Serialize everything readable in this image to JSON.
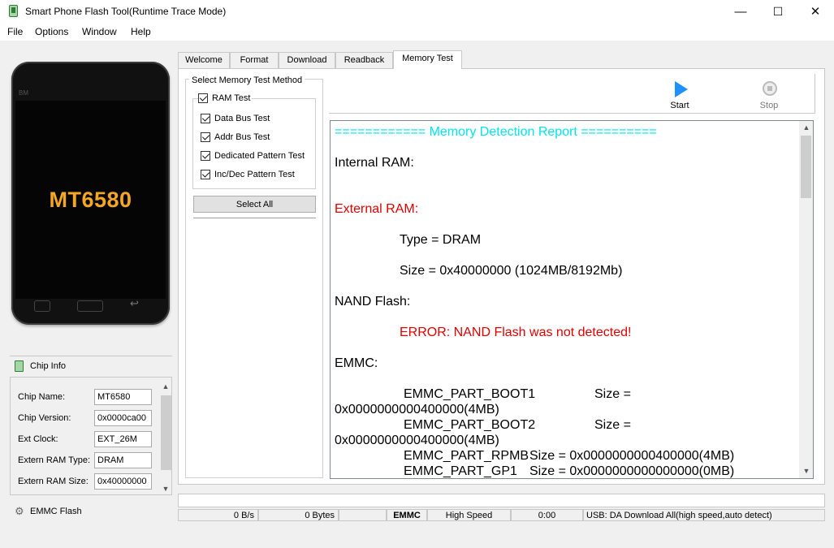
{
  "window": {
    "title": "Smart Phone Flash Tool(Runtime Trace Mode)",
    "minimize": "—",
    "maximize": "☐",
    "close": "✕"
  },
  "menu": [
    "File",
    "Options",
    "Window",
    "Help"
  ],
  "phone": {
    "brand": "BM",
    "chip": "MT6580"
  },
  "tabs": [
    "Welcome",
    "Format",
    "Download",
    "Readback",
    "Memory Test"
  ],
  "active_tab": "Memory Test",
  "method": {
    "title": "Select Memory Test Method",
    "ram_test": "RAM Test",
    "options": [
      "Data Bus Test",
      "Addr Bus Test",
      "Dedicated Pattern Test",
      "Inc/Dec Pattern Test"
    ],
    "select_all": "Select All"
  },
  "toolbar": {
    "start": "Start",
    "stop": "Stop"
  },
  "report": {
    "lines": [
      "============ Memory Detection Report ==========",
      "Internal RAM:",
      "External RAM:",
      "Type = DRAM",
      "Size = 0x40000000 (1024MB/8192Mb)",
      "NAND Flash:",
      "ERROR: NAND Flash was not detected!",
      "EMMC:",
      "EMMC_PART_BOOT1",
      "Size =",
      "0x0000000000400000(4MB)",
      "EMMC_PART_BOOT2",
      "Size =",
      "0x0000000000400000(4MB)",
      "EMMC_PART_RPMB",
      "Size = 0x0000000000400000(4MB)",
      "EMMC_PART_GP1",
      "Size = 0x0000000000000000(0MB)"
    ]
  },
  "chip_info": {
    "title": "Chip Info",
    "rows": [
      {
        "label": "Chip Name:",
        "value": "MT6580"
      },
      {
        "label": "Chip Version:",
        "value": "0x0000ca00"
      },
      {
        "label": "Ext Clock:",
        "value": "EXT_26M"
      },
      {
        "label": "Extern RAM Type:",
        "value": "DRAM"
      },
      {
        "label": "Extern RAM Size:",
        "value": "0x40000000"
      }
    ]
  },
  "emmc_flash": "EMMC Flash",
  "status": {
    "speed": "0 B/s",
    "bytes": "0 Bytes",
    "storage": "EMMC",
    "mode": "High Speed",
    "time": "0:00",
    "usb": "USB: DA Download All(high speed,auto detect)"
  }
}
